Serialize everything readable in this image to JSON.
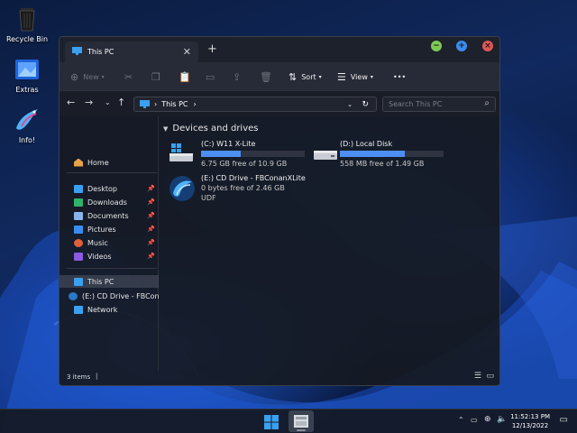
{
  "desktop": {
    "icons": [
      {
        "label": "Recycle Bin"
      },
      {
        "label": "Extras"
      },
      {
        "label": "Info!"
      }
    ]
  },
  "window": {
    "tab_title": "This PC",
    "new_tab_symbol": "+",
    "toolbar": {
      "new_label": "New",
      "sort_label": "Sort",
      "view_label": "View",
      "more_label": "•••"
    },
    "address": {
      "path_label": "This PC",
      "search_placeholder": "Search This PC"
    },
    "nav": {
      "home": "Home",
      "quick": [
        {
          "label": "Desktop"
        },
        {
          "label": "Downloads"
        },
        {
          "label": "Documents"
        },
        {
          "label": "Pictures"
        },
        {
          "label": "Music"
        },
        {
          "label": "Videos"
        }
      ],
      "this_pc": "This PC",
      "cd_drive": "(E:) CD Drive - FBConanXLite",
      "network": "Network"
    },
    "section_title": "Devices and drives",
    "drives": [
      {
        "name": "(C:) W11 X-Lite",
        "free": "6.75 GB free of 10.9 GB",
        "used_fraction": 0.38
      },
      {
        "name": "(D:) Local Disk",
        "free": "558 MB free of 1.49 GB",
        "used_fraction": 0.63
      },
      {
        "name": "(E:) CD Drive - FBConanXLite",
        "free": "0 bytes free of 2.46 GB",
        "fs": "UDF"
      }
    ],
    "status": {
      "items_count": "3 items"
    }
  },
  "taskbar": {
    "time": "11:52:13 PM",
    "date": "12/13/2022"
  },
  "colors": {
    "accent": "#4d8ef2",
    "min_button": "#7dc855",
    "max_button": "#3a8df0",
    "close_button": "#e05555"
  }
}
